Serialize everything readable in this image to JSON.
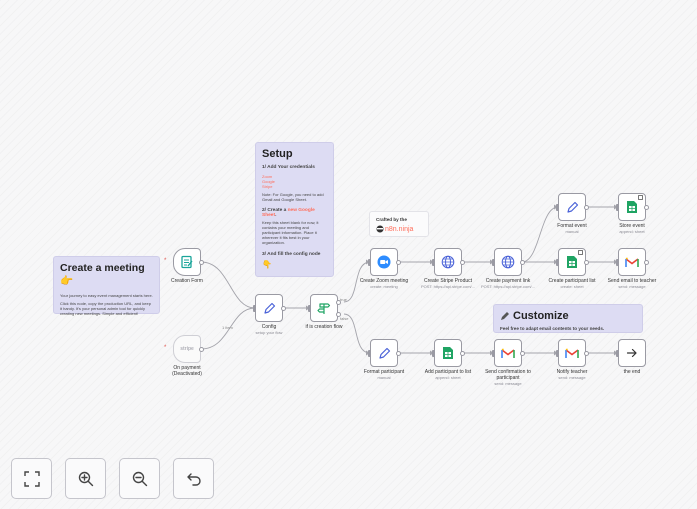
{
  "notes": {
    "create_meeting": {
      "title": "Create a meeting",
      "emoji": "👉",
      "line1": "Your journey to easy event management starts here.",
      "line2": "Click this node, copy the production URL, and keep it handy. It's your personal admin tool for quickly creating new meetings. Simple and efficient!"
    },
    "setup": {
      "title": "Setup",
      "s1": "1/ Add Your credentials",
      "creds": [
        "Zoom",
        "Google",
        "Stripe"
      ],
      "s1_note": "Note: For Google, you need to add Gmail and Google Sheet.",
      "s2_pre": "2/ Create a ",
      "s2_link": "new Google Sheet",
      "s2_post": ".",
      "s2_text": "Keep this sheet blank for now, it contains your meeting and participant information. Place it wherever it fits best in your organization.",
      "s3": "3/ And fill the config node",
      "emoji": "👇"
    },
    "crafted": {
      "title": "Crafted by the",
      "brand": "n8n.ninja"
    },
    "customize": {
      "title": "Customize",
      "text": "Feel free to adapt email contents to your needs.",
      "icon": "pencil-icon"
    }
  },
  "nodes": {
    "creation_form": {
      "name": "Creation Form"
    },
    "on_payment": {
      "name": "On payment",
      "name2": "(Deactivated)",
      "badge": "stripe"
    },
    "config": {
      "name": "Config",
      "sub": "setup your flow"
    },
    "if_creation": {
      "name": "if is creation flow"
    },
    "zoom": {
      "name": "Create Zoom meeting",
      "sub": "create: meeting"
    },
    "stripe_product": {
      "name": "Create Stripe Product",
      "sub": "POST: https://api.stripe.com/..."
    },
    "payment_link": {
      "name": "Create payment link",
      "sub": "POST: https://api.stripe.com/..."
    },
    "format_event": {
      "name": "Format event",
      "sub": "manual"
    },
    "store_event": {
      "name": "Store event",
      "sub": "append: sheet"
    },
    "create_participant_list": {
      "name": "Create participant list",
      "sub": "create: sheet"
    },
    "send_email_teacher": {
      "name": "Send email to teacher",
      "sub": "send: message"
    },
    "format_participant": {
      "name": "Format participant",
      "sub": "manual"
    },
    "add_participant": {
      "name": "Add participant to list",
      "sub": "append: sheet"
    },
    "send_confirmation": {
      "name": "Send confirmation to",
      "name2": "participant",
      "sub": "send: message"
    },
    "notify_teacher": {
      "name": "Notify teacher",
      "sub": "send: message"
    },
    "the_end": {
      "name": "the end"
    }
  },
  "edge_labels": {
    "config_in": "1 item",
    "true": "true",
    "false": "false"
  },
  "toolbar": {
    "fit": "fit-view-icon",
    "zoom_in": "zoom-in-icon",
    "zoom_out": "zoom-out-icon",
    "undo": "undo-icon"
  },
  "colors": {
    "accent": "#ff6d5a",
    "zoom": "#2d8cff",
    "sheets": "#1fa463",
    "gmail_red": "#ea4335",
    "pencil": "#4a62d8"
  }
}
